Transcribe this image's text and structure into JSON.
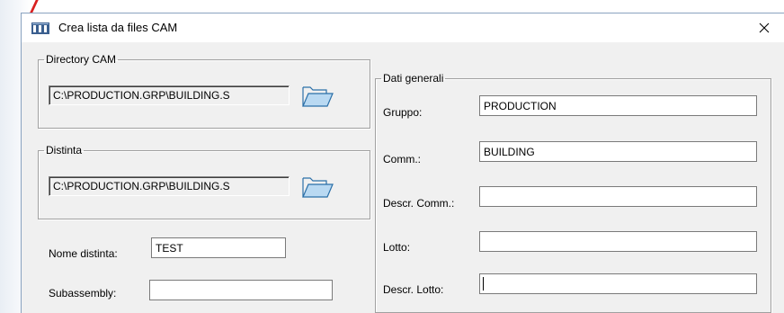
{
  "window": {
    "title": "Crea lista da files CAM",
    "close_symbol": "✕"
  },
  "directory_cam": {
    "legend": "Directory CAM",
    "path": "C:\\PRODUCTION.GRP\\BUILDING.S",
    "browse_icon": "folder-open-icon"
  },
  "distinta": {
    "legend": "Distinta",
    "path": "C:\\PRODUCTION.GRP\\BUILDING.S",
    "browse_icon": "folder-open-icon"
  },
  "nome_distinta": {
    "label": "Nome distinta:",
    "value": "TEST"
  },
  "subassembly": {
    "label": "Subassembly:",
    "value": ""
  },
  "dati_generali": {
    "legend": "Dati generali",
    "gruppo": {
      "label": "Gruppo:",
      "value": "PRODUCTION"
    },
    "comm": {
      "label": "Comm.:",
      "value": "BUILDING"
    },
    "descr_comm": {
      "label": "Descr. Comm.:",
      "value": ""
    },
    "lotto": {
      "label": "Lotto:",
      "value": ""
    },
    "descr_lotto": {
      "label": "Descr. Lotto:",
      "value": ""
    }
  }
}
